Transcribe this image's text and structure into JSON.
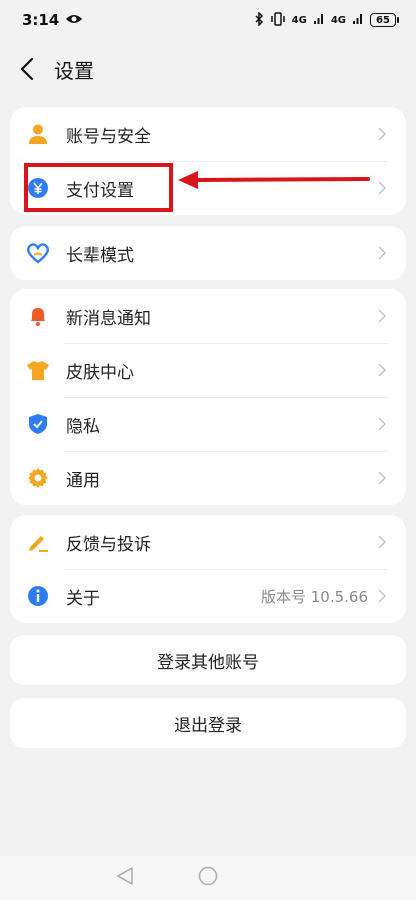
{
  "status_bar": {
    "time": "3:14",
    "signal_1": "4G",
    "signal_2": "4G",
    "battery": "65"
  },
  "header": {
    "title": "设置"
  },
  "groups": [
    {
      "items": [
        {
          "label": "账号与安全",
          "icon": "person-icon",
          "color": "#f5a623"
        },
        {
          "label": "支付设置",
          "icon": "yuan-icon",
          "color": "#2f7df6"
        }
      ]
    },
    {
      "items": [
        {
          "label": "长辈模式",
          "icon": "elder-heart-icon",
          "color": "#2f7df6"
        }
      ]
    },
    {
      "items": [
        {
          "label": "新消息通知",
          "icon": "bell-icon",
          "color": "#f05a28"
        },
        {
          "label": "皮肤中心",
          "icon": "shirt-icon",
          "color": "#f5a623"
        },
        {
          "label": "隐私",
          "icon": "shield-icon",
          "color": "#2f7df6"
        },
        {
          "label": "通用",
          "icon": "gear-icon",
          "color": "#f5a623"
        }
      ]
    },
    {
      "items": [
        {
          "label": "反馈与投诉",
          "icon": "pen-icon",
          "color": "#f5a623"
        },
        {
          "label": "关于",
          "icon": "info-icon",
          "color": "#2f7df6",
          "value": "版本号 10.5.66"
        }
      ]
    }
  ],
  "buttons": {
    "login_other": "登录其他账号",
    "logout": "退出登录"
  },
  "annotation": {
    "highlight_color": "#d9141b"
  }
}
